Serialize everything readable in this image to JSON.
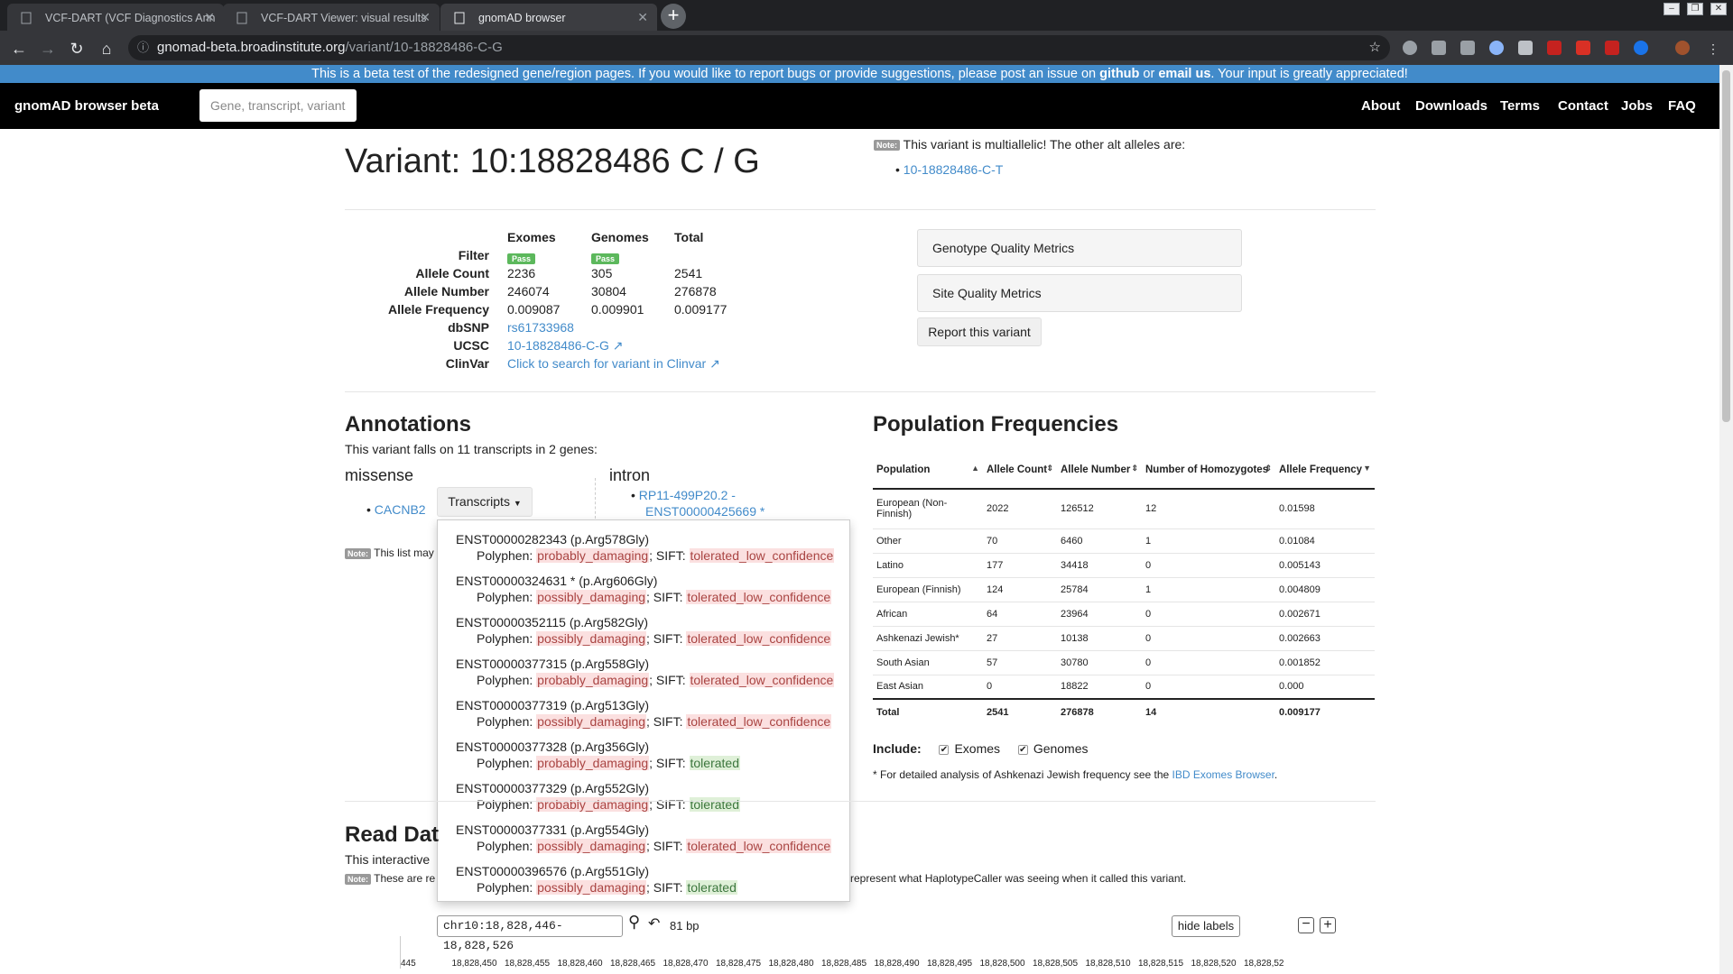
{
  "browser": {
    "tabs": [
      {
        "title": "VCF-DART (VCF Diagnostics Ann"
      },
      {
        "title": "VCF-DART Viewer: visual results "
      },
      {
        "title": "gnomAD browser"
      }
    ],
    "url_host": "gnomad-beta.broadinstitute.org",
    "url_path": "/variant/10-18828486-C-G",
    "new_tab": "+"
  },
  "banner": {
    "text_start": "This is a beta test of the redesigned gene/region pages. If you would like to report bugs or provide suggestions, please post an issue on ",
    "github": "github",
    "or": " or ",
    "email": "email us",
    "text_end": ". Your input is greatly appreciated!"
  },
  "header": {
    "brand": "gnomAD browser beta",
    "search_placeholder": "Gene, transcript, variant",
    "nav": [
      "About",
      "Downloads",
      "Terms",
      "Contact",
      "Jobs",
      "FAQ"
    ]
  },
  "variant": {
    "title": "Variant: 10:18828486 C / G",
    "note_label": "Note:",
    "multiallelic_text": "This variant is multiallelic! The other alt alleles are:",
    "other_allele": "10-18828486-C-T"
  },
  "summary": {
    "col_exomes": "Exomes",
    "col_genomes": "Genomes",
    "col_total": "Total",
    "filter_label": "Filter",
    "pass": "Pass",
    "ac_label": "Allele Count",
    "ac": [
      "2236",
      "305",
      "2541"
    ],
    "an_label": "Allele Number",
    "an": [
      "246074",
      "30804",
      "276878"
    ],
    "af_label": "Allele Frequency",
    "af": [
      "0.009087",
      "0.009901",
      "0.009177"
    ],
    "dbsnp_label": "dbSNP",
    "dbsnp": "rs61733968",
    "ucsc_label": "UCSC",
    "ucsc": "10-18828486-C-G",
    "clinvar_label": "ClinVar",
    "clinvar": "Click to search for variant in Clinvar"
  },
  "metrics": {
    "genotype": "Genotype Quality Metrics",
    "site": "Site Quality Metrics",
    "report": "Report this variant"
  },
  "annotations": {
    "title": "Annotations",
    "subtitle": "This variant falls on 11 transcripts in 2 genes:",
    "missense": "missense",
    "gene": "CACNB2",
    "transcripts_btn": "Transcripts",
    "intron": "intron",
    "intron_gene": "RP11-499P20.2 -",
    "intron_transcript": "ENST00000425669 *",
    "note_text": "This list may",
    "polyphen": "Polyphen: ",
    "sift": "; SIFT: ",
    "transcripts": [
      {
        "id": "ENST00000282343 (p.Arg578Gly)",
        "polyphen": "probably_damaging",
        "sift": "tolerated_low_confidence",
        "pclass": "pd",
        "sclass": "pd"
      },
      {
        "id": "ENST00000324631 * (p.Arg606Gly)",
        "polyphen": "possibly_damaging",
        "sift": "tolerated_low_confidence",
        "pclass": "pp",
        "sclass": "pd"
      },
      {
        "id": "ENST00000352115 (p.Arg582Gly)",
        "polyphen": "possibly_damaging",
        "sift": "tolerated_low_confidence",
        "pclass": "pp",
        "sclass": "pd"
      },
      {
        "id": "ENST00000377315 (p.Arg558Gly)",
        "polyphen": "probably_damaging",
        "sift": "tolerated_low_confidence",
        "pclass": "pd",
        "sclass": "pd"
      },
      {
        "id": "ENST00000377319 (p.Arg513Gly)",
        "polyphen": "possibly_damaging",
        "sift": "tolerated_low_confidence",
        "pclass": "pp",
        "sclass": "pd"
      },
      {
        "id": "ENST00000377328 (p.Arg356Gly)",
        "polyphen": "probably_damaging",
        "sift": "tolerated",
        "pclass": "pd",
        "sclass": "tol"
      },
      {
        "id": "ENST00000377329 (p.Arg552Gly)",
        "polyphen": "probably_damaging",
        "sift": "tolerated",
        "pclass": "pd",
        "sclass": "tol"
      },
      {
        "id": "ENST00000377331 (p.Arg554Gly)",
        "polyphen": "possibly_damaging",
        "sift": "tolerated_low_confidence",
        "pclass": "pp",
        "sclass": "pd"
      },
      {
        "id": "ENST00000396576 (p.Arg551Gly)",
        "polyphen": "possibly_damaging",
        "sift": "tolerated",
        "pclass": "pp",
        "sclass": "tol"
      }
    ]
  },
  "population": {
    "title": "Population Frequencies",
    "headers": [
      "Population",
      "Allele Count",
      "Allele Number",
      "Number of Homozygotes",
      "Allele Frequency"
    ],
    "rows": [
      [
        "European (Non-Finnish)",
        "2022",
        "126512",
        "12",
        "0.01598"
      ],
      [
        "Other",
        "70",
        "6460",
        "1",
        "0.01084"
      ],
      [
        "Latino",
        "177",
        "34418",
        "0",
        "0.005143"
      ],
      [
        "European (Finnish)",
        "124",
        "25784",
        "1",
        "0.004809"
      ],
      [
        "African",
        "64",
        "23964",
        "0",
        "0.002671"
      ],
      [
        "Ashkenazi Jewish*",
        "27",
        "10138",
        "0",
        "0.002663"
      ],
      [
        "South Asian",
        "57",
        "30780",
        "0",
        "0.001852"
      ],
      [
        "East Asian",
        "0",
        "18822",
        "0",
        "0.000"
      ]
    ],
    "total": [
      "Total",
      "2541",
      "276878",
      "14",
      "0.009177"
    ],
    "include_label": "Include:",
    "exomes": "Exomes",
    "genomes": "Genomes",
    "footnote_start": "* For detailed analysis of Ashkenazi Jewish frequency see the ",
    "footnote_link": "IBD Exomes Browser",
    "footnote_end": "."
  },
  "read_data": {
    "title": "Read Dat",
    "intro": "This interactive",
    "note_text": "These are re",
    "note_end": "represent what HaplotypeCaller was seeing when it called this variant.",
    "locus": "chr10:18,828,446-18,828,526",
    "bp": "81 bp",
    "hide_labels": "hide labels",
    "ticks": [
      "445",
      "18,828,450",
      "18,828,455",
      "18,828,460",
      "18,828,465",
      "18,828,470",
      "18,828,475",
      "18,828,480",
      "18,828,485",
      "18,828,490",
      "18,828,495",
      "18,828,500",
      "18,828,505",
      "18,828,510",
      "18,828,515",
      "18,828,520",
      "18,828,52"
    ]
  }
}
